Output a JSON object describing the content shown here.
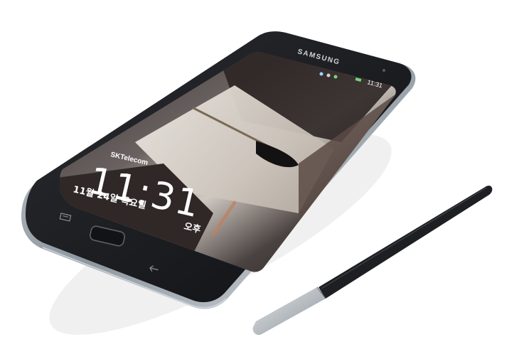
{
  "phone": {
    "brand": "SAMSUNG",
    "status_time": "11:31"
  },
  "lockscreen": {
    "carrier": "SKTelecom",
    "time": "11:31",
    "date": "11월 24일 목요일",
    "ampm": "오후"
  },
  "colors": {
    "background": "#ffffff",
    "phone_body": "#1a1b1f",
    "phone_rim": "#9aa3ad",
    "stylus_body": "#1e1f22",
    "stylus_tip": "#b9bec4"
  }
}
